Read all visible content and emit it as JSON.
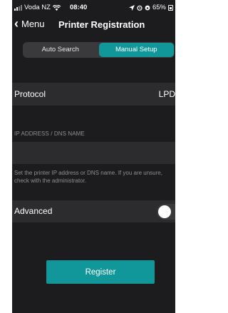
{
  "status_bar": {
    "carrier": "Voda NZ",
    "time": "08:40",
    "battery": "65%"
  },
  "nav": {
    "back_label": "Menu",
    "title": "Printer Registration"
  },
  "segmented": {
    "tabs": [
      {
        "label": "Auto Search",
        "selected": false
      },
      {
        "label": "Manual Setup",
        "selected": true
      }
    ]
  },
  "form": {
    "protocol_label": "Protocol",
    "protocol_value": "LPD",
    "ip_header": "IP ADDRESS / DNS NAME",
    "ip_value": "",
    "help_text": "Set the printer IP address or DNS name. If you are unsure, check with the administrator.",
    "advanced_label": "Advanced",
    "advanced_enabled": false
  },
  "actions": {
    "register_label": "Register"
  },
  "colors": {
    "accent": "#119799",
    "background": "#1c1c1e",
    "row_background": "#2c2c2e",
    "secondary_text": "#8e8e93"
  },
  "icons": [
    "signal-icon",
    "wifi-icon",
    "location-icon",
    "alarm-icon",
    "battery-icon",
    "back-chevron-icon"
  ]
}
